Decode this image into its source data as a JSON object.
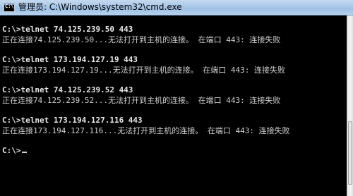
{
  "window": {
    "title": "管理员: C:\\Windows\\system32\\cmd.exe",
    "icon_prompt": "C:\\"
  },
  "console": {
    "lines": [
      {
        "kind": "command",
        "text": "C:\\>telnet 74.125.239.50 443"
      },
      {
        "kind": "output",
        "text": "正在连接74.125.239.50...无法打开到主机的连接。 在端口 443: 连接失败"
      },
      {
        "kind": "command",
        "text": "C:\\>telnet 173.194.127.19 443"
      },
      {
        "kind": "output",
        "text": "正在连接173.194.127.19...无法打开到主机的连接。 在端口 443: 连接失败"
      },
      {
        "kind": "command",
        "text": "C:\\>telnet 74.125.239.52 443"
      },
      {
        "kind": "output",
        "text": "正在连接74.125.239.52...无法打开到主机的连接。 在端口 443: 连接失败"
      },
      {
        "kind": "command",
        "text": "C:\\>telnet 173.194.127.116 443"
      },
      {
        "kind": "output",
        "text": "正在连接173.194.127.116...无法打开到主机的连接。 在端口 443: 连接失败"
      },
      {
        "kind": "prompt",
        "text": "C:\\>"
      }
    ]
  },
  "colors": {
    "console_bg": "#000000",
    "console_fg": "#d0d0d0",
    "titlebar": "#aac8e8"
  }
}
